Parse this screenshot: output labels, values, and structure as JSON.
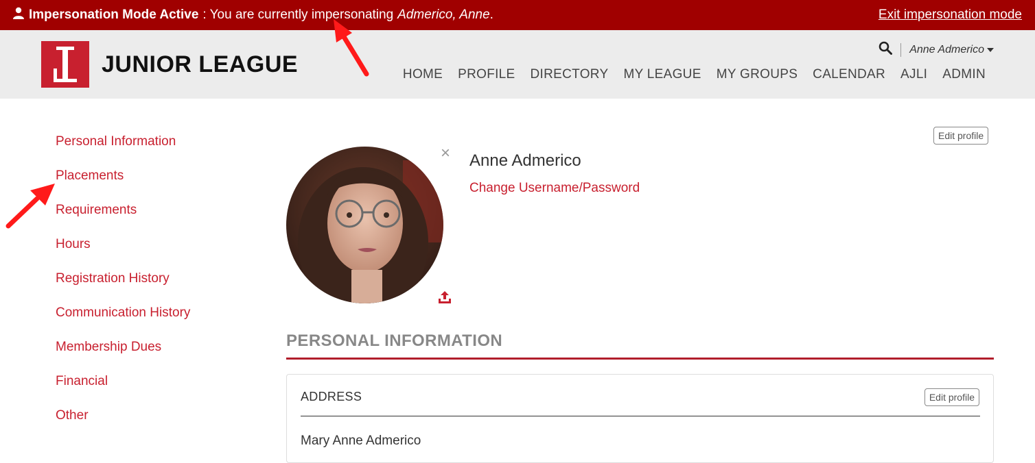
{
  "banner": {
    "mode_label": "Impersonation Mode Active",
    "message_prefix": ": You are currently impersonating",
    "impersonated_name": "Admerico, Anne",
    "message_suffix": ".",
    "exit_label": "Exit impersonation mode",
    "icons": {
      "user": "user-icon"
    }
  },
  "header": {
    "logo_text": "JUNIOR LEAGUE",
    "user_menu_label": "Anne Admerico",
    "icons": {
      "search": "search-icon",
      "dropdown": "chevron-down-icon"
    },
    "nav": [
      "HOME",
      "PROFILE",
      "DIRECTORY",
      "MY LEAGUE",
      "MY GROUPS",
      "CALENDAR",
      "AJLI",
      "ADMIN"
    ]
  },
  "sidebar": {
    "items": [
      "Personal Information",
      "Placements",
      "Requirements",
      "Hours",
      "Registration History",
      "Communication History",
      "Membership Dues",
      "Financial",
      "Other"
    ]
  },
  "profile": {
    "edit_label": "Edit profile",
    "name": "Anne Admerico",
    "change_link": "Change Username/Password",
    "close_symbol": "×",
    "icons": {
      "close": "close-icon",
      "upload": "upload-icon"
    }
  },
  "personal_information": {
    "section_title": "PERSONAL INFORMATION",
    "address": {
      "title": "ADDRESS",
      "edit_label": "Edit profile",
      "line1": "Mary Anne Admerico"
    }
  },
  "colors": {
    "banner_bg": "#a00000",
    "brand_red": "#c8202f",
    "header_bg": "#ececec",
    "annotation_arrow": "#ff1a1a"
  }
}
